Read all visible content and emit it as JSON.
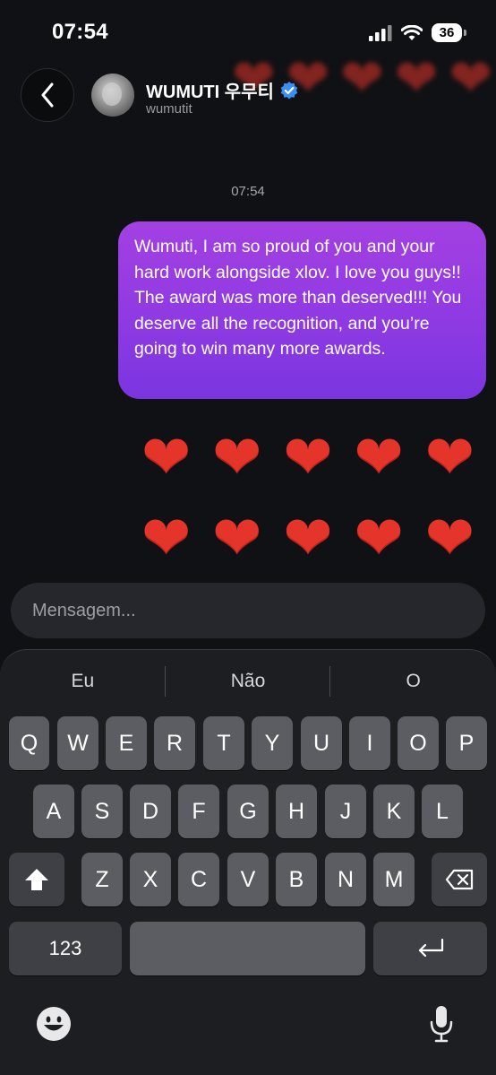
{
  "status_bar": {
    "time": "07:54",
    "battery": "36"
  },
  "header": {
    "name": "WUMUTI 우무티",
    "handle": "wumutit",
    "verified_icon": "verified-badge-icon"
  },
  "conversation": {
    "timestamp": "07:54",
    "messages": [
      {
        "sender": "me",
        "text": "Wumuti, I am so proud of you and your hard work alongside xlov. I love you guys!! The award was more than deserved!!! You deserve all the recognition, and you’re going to win many more awards."
      }
    ],
    "hearts": [
      "❤",
      "❤",
      "❤",
      "❤",
      "❤",
      "❤",
      "❤",
      "❤",
      "❤",
      "❤"
    ]
  },
  "composer": {
    "placeholder": "Mensagem..."
  },
  "keyboard": {
    "suggestions": [
      "Eu",
      "Não",
      "O"
    ],
    "row1": [
      "Q",
      "W",
      "E",
      "R",
      "T",
      "Y",
      "U",
      "I",
      "O",
      "P"
    ],
    "row2": [
      "A",
      "S",
      "D",
      "F",
      "G",
      "H",
      "J",
      "K",
      "L"
    ],
    "row3": [
      "Z",
      "X",
      "C",
      "V",
      "B",
      "N",
      "M"
    ],
    "numbers_label": "123"
  },
  "colors": {
    "bubble": "#9a3de2",
    "background": "#101114",
    "heart": "#e5352a"
  }
}
